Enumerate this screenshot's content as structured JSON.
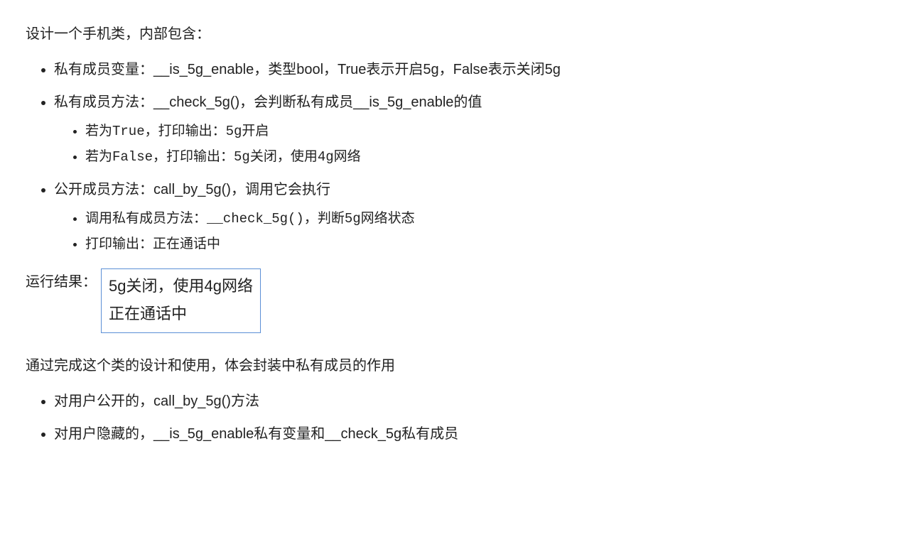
{
  "intro": "设计一个手机类，内部包含：",
  "items": [
    {
      "text": "私有成员变量：__is_5g_enable，类型bool，True表示开启5g，False表示关闭5g",
      "sub": []
    },
    {
      "text": "私有成员方法：__check_5g()，会判断私有成员__is_5g_enable的值",
      "sub": [
        "若为True，打印输出：5g开启",
        "若为False，打印输出：5g关闭，使用4g网络"
      ]
    },
    {
      "text": "公开成员方法：call_by_5g()，调用它会执行",
      "sub": [
        "调用私有成员方法：__check_5g()，判断5g网络状态",
        "打印输出：正在通话中"
      ]
    }
  ],
  "run": {
    "label": "运行结果：",
    "lines": [
      "5g关闭，使用4g网络",
      "正在通话中"
    ]
  },
  "summary": "通过完成这个类的设计和使用，体会封装中私有成员的作用",
  "summary_items": [
    "对用户公开的，call_by_5g()方法",
    "对用户隐藏的，__is_5g_enable私有变量和__check_5g私有成员"
  ]
}
